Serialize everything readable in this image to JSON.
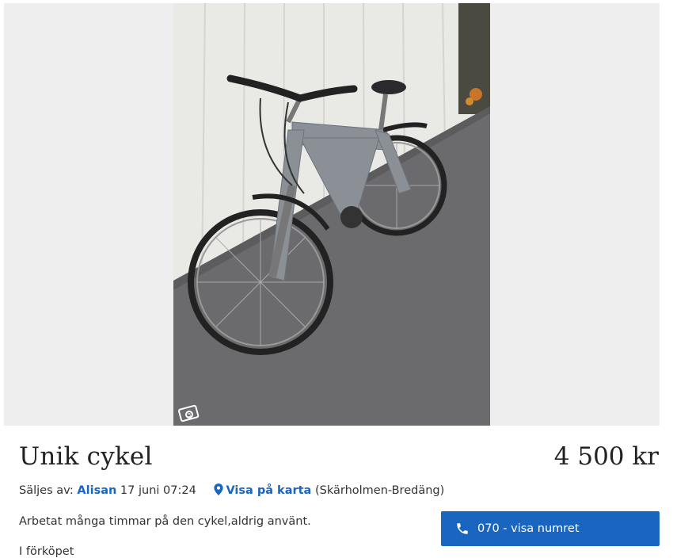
{
  "listing": {
    "title": "Unik cykel",
    "price": "4 500 kr",
    "seller_prefix": "Säljes av:",
    "seller_name": "Alisan",
    "posted": "17 juni 07:24",
    "map_link": "Visa på karta",
    "location": "(Skärholmen-Bredäng)",
    "description": "Arbetat många timmar på den cykel,aldrig använt.",
    "description_cont": "I förköpet"
  },
  "contact": {
    "phone_label": "070 - visa numret"
  },
  "colors": {
    "accent": "#1a65bf",
    "gallery_bg": "#eeeeee"
  },
  "icons": {
    "camera": "camera-icon",
    "pin": "map-pin-icon",
    "phone": "phone-icon"
  }
}
